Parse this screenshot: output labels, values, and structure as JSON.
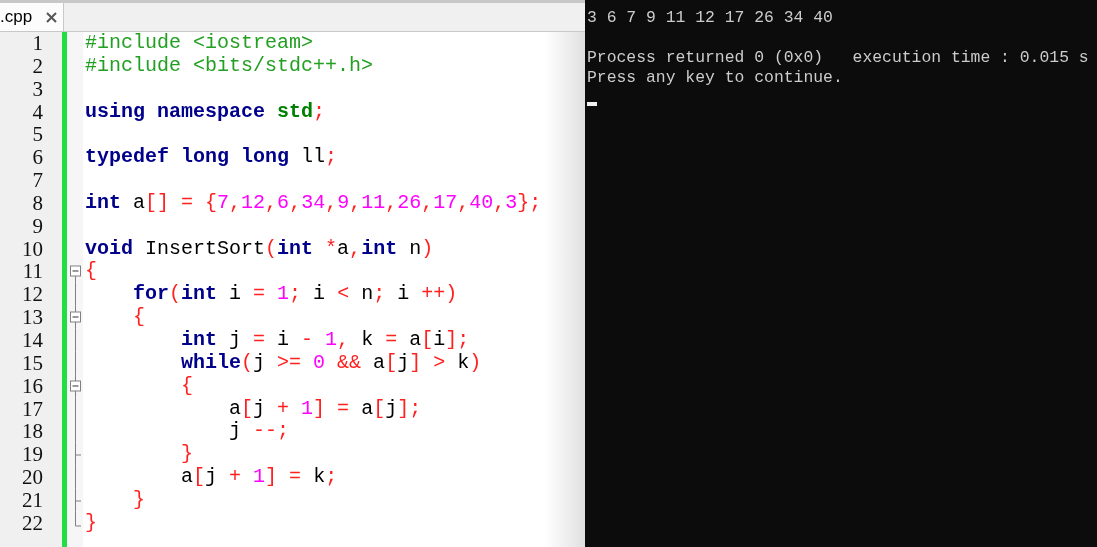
{
  "editor": {
    "tab": {
      "label": ".cpp",
      "selected": true
    },
    "lines": [
      {
        "number": "1",
        "tokens": [
          {
            "kind": "preproc",
            "text": "#include <iostream>"
          }
        ]
      },
      {
        "number": "2",
        "tokens": [
          {
            "kind": "preproc",
            "text": "#include <bits/stdc++.h>"
          }
        ]
      },
      {
        "number": "3"
      },
      {
        "number": "4",
        "tokens": [
          {
            "kind": "keyword",
            "text": "using"
          },
          {
            "kind": "keyword",
            "text": " namespace"
          },
          {
            "kind": "type",
            "text": " std"
          },
          {
            "kind": "symbol",
            "text": ";"
          }
        ]
      },
      {
        "number": "5"
      },
      {
        "number": "6",
        "tokens": [
          {
            "kind": "keyword",
            "text": "typedef"
          },
          {
            "kind": "keyword",
            "text": " long"
          },
          {
            "kind": "keyword",
            "text": " long"
          },
          {
            "kind": "plain",
            "text": " ll"
          },
          {
            "kind": "symbol",
            "text": ";"
          }
        ]
      },
      {
        "number": "7"
      },
      {
        "number": "8",
        "tokens": [
          {
            "kind": "keyword",
            "text": "int"
          },
          {
            "kind": "plain",
            "text": " a"
          },
          {
            "kind": "symbol",
            "text": "[] = {"
          },
          {
            "kind": "number",
            "text": "7"
          },
          {
            "kind": "symbol",
            "text": ","
          },
          {
            "kind": "number",
            "text": "12"
          },
          {
            "kind": "symbol",
            "text": ","
          },
          {
            "kind": "number",
            "text": "6"
          },
          {
            "kind": "symbol",
            "text": ","
          },
          {
            "kind": "number",
            "text": "34"
          },
          {
            "kind": "symbol",
            "text": ","
          },
          {
            "kind": "number",
            "text": "9"
          },
          {
            "kind": "symbol",
            "text": ","
          },
          {
            "kind": "number",
            "text": "11"
          },
          {
            "kind": "symbol",
            "text": ","
          },
          {
            "kind": "number",
            "text": "26"
          },
          {
            "kind": "symbol",
            "text": ","
          },
          {
            "kind": "number",
            "text": "17"
          },
          {
            "kind": "symbol",
            "text": ","
          },
          {
            "kind": "number",
            "text": "40"
          },
          {
            "kind": "symbol",
            "text": ","
          },
          {
            "kind": "number",
            "text": "3"
          },
          {
            "kind": "symbol",
            "text": "};"
          }
        ]
      },
      {
        "number": "9"
      },
      {
        "number": "10",
        "tokens": [
          {
            "kind": "keyword",
            "text": "void"
          },
          {
            "kind": "plain",
            "text": " InsertSort"
          },
          {
            "kind": "symbol",
            "text": "("
          },
          {
            "kind": "keyword",
            "text": "int"
          },
          {
            "kind": "symbol",
            "text": " *"
          },
          {
            "kind": "plain",
            "text": "a"
          },
          {
            "kind": "symbol",
            "text": ","
          },
          {
            "kind": "keyword",
            "text": "int"
          },
          {
            "kind": "plain",
            "text": " n"
          },
          {
            "kind": "symbol",
            "text": ")"
          }
        ]
      },
      {
        "number": "11",
        "fold": {
          "kind": "start"
        },
        "tokens": [
          {
            "kind": "symbol",
            "text": "{"
          }
        ]
      },
      {
        "number": "12",
        "fold": {
          "kind": "mid"
        },
        "tokens": [
          {
            "kind": "keyword",
            "text": "    for"
          },
          {
            "kind": "symbol",
            "text": "("
          },
          {
            "kind": "keyword",
            "text": "int"
          },
          {
            "kind": "plain",
            "text": " i "
          },
          {
            "kind": "symbol",
            "text": "="
          },
          {
            "kind": "number",
            "text": " 1"
          },
          {
            "kind": "symbol",
            "text": ";"
          },
          {
            "kind": "plain",
            "text": " i "
          },
          {
            "kind": "symbol",
            "text": "<"
          },
          {
            "kind": "plain",
            "text": " n"
          },
          {
            "kind": "symbol",
            "text": ";"
          },
          {
            "kind": "plain",
            "text": " i "
          },
          {
            "kind": "symbol",
            "text": "++)"
          }
        ]
      },
      {
        "number": "13",
        "fold": {
          "kind": "start"
        },
        "tokens": [
          {
            "kind": "symbol",
            "text": "    {"
          }
        ]
      },
      {
        "number": "14",
        "fold": {
          "kind": "mid"
        },
        "tokens": [
          {
            "kind": "keyword",
            "text": "        int"
          },
          {
            "kind": "plain",
            "text": " j "
          },
          {
            "kind": "symbol",
            "text": "="
          },
          {
            "kind": "plain",
            "text": " i "
          },
          {
            "kind": "symbol",
            "text": "-"
          },
          {
            "kind": "number",
            "text": " 1"
          },
          {
            "kind": "symbol",
            "text": ","
          },
          {
            "kind": "plain",
            "text": " k "
          },
          {
            "kind": "symbol",
            "text": "="
          },
          {
            "kind": "plain",
            "text": " a"
          },
          {
            "kind": "symbol",
            "text": "["
          },
          {
            "kind": "plain",
            "text": "i"
          },
          {
            "kind": "symbol",
            "text": "];"
          }
        ]
      },
      {
        "number": "15",
        "fold": {
          "kind": "mid"
        },
        "tokens": [
          {
            "kind": "keyword",
            "text": "        while"
          },
          {
            "kind": "symbol",
            "text": "("
          },
          {
            "kind": "plain",
            "text": "j "
          },
          {
            "kind": "symbol",
            "text": ">="
          },
          {
            "kind": "number",
            "text": " 0"
          },
          {
            "kind": "symbol",
            "text": " &&"
          },
          {
            "kind": "plain",
            "text": " a"
          },
          {
            "kind": "symbol",
            "text": "["
          },
          {
            "kind": "plain",
            "text": "j"
          },
          {
            "kind": "symbol",
            "text": "]"
          },
          {
            "kind": "symbol",
            "text": " >"
          },
          {
            "kind": "plain",
            "text": " k"
          },
          {
            "kind": "symbol",
            "text": ")"
          }
        ]
      },
      {
        "number": "16",
        "fold": {
          "kind": "start"
        },
        "tokens": [
          {
            "kind": "symbol",
            "text": "        {"
          }
        ]
      },
      {
        "number": "17",
        "fold": {
          "kind": "mid"
        },
        "tokens": [
          {
            "kind": "plain",
            "text": "            a"
          },
          {
            "kind": "symbol",
            "text": "["
          },
          {
            "kind": "plain",
            "text": "j "
          },
          {
            "kind": "symbol",
            "text": "+"
          },
          {
            "kind": "number",
            "text": " 1"
          },
          {
            "kind": "symbol",
            "text": "]"
          },
          {
            "kind": "symbol",
            "text": " ="
          },
          {
            "kind": "plain",
            "text": " a"
          },
          {
            "kind": "symbol",
            "text": "["
          },
          {
            "kind": "plain",
            "text": "j"
          },
          {
            "kind": "symbol",
            "text": "];"
          }
        ]
      },
      {
        "number": "18",
        "fold": {
          "kind": "mid"
        },
        "tokens": [
          {
            "kind": "plain",
            "text": "            j "
          },
          {
            "kind": "symbol",
            "text": "--;"
          }
        ]
      },
      {
        "number": "19",
        "fold": {
          "kind": "end"
        },
        "tokens": [
          {
            "kind": "symbol",
            "text": "        }"
          }
        ]
      },
      {
        "number": "20",
        "fold": {
          "kind": "mid"
        },
        "tokens": [
          {
            "kind": "plain",
            "text": "        a"
          },
          {
            "kind": "symbol",
            "text": "["
          },
          {
            "kind": "plain",
            "text": "j "
          },
          {
            "kind": "symbol",
            "text": "+"
          },
          {
            "kind": "number",
            "text": " 1"
          },
          {
            "kind": "symbol",
            "text": "]"
          },
          {
            "kind": "symbol",
            "text": " ="
          },
          {
            "kind": "plain",
            "text": " k"
          },
          {
            "kind": "symbol",
            "text": ";"
          }
        ]
      },
      {
        "number": "21",
        "fold": {
          "kind": "end"
        },
        "tokens": [
          {
            "kind": "symbol",
            "text": "    }"
          }
        ]
      },
      {
        "number": "22",
        "fold": {
          "kind": "last"
        },
        "tokens": [
          {
            "kind": "symbol",
            "text": "}"
          }
        ]
      }
    ]
  },
  "console": {
    "output": "3 6 7 9 11 12 17 26 34 40",
    "status": "Process returned 0 (0x0)   execution time : 0.015 s",
    "prompt": "Press any key to continue."
  }
}
